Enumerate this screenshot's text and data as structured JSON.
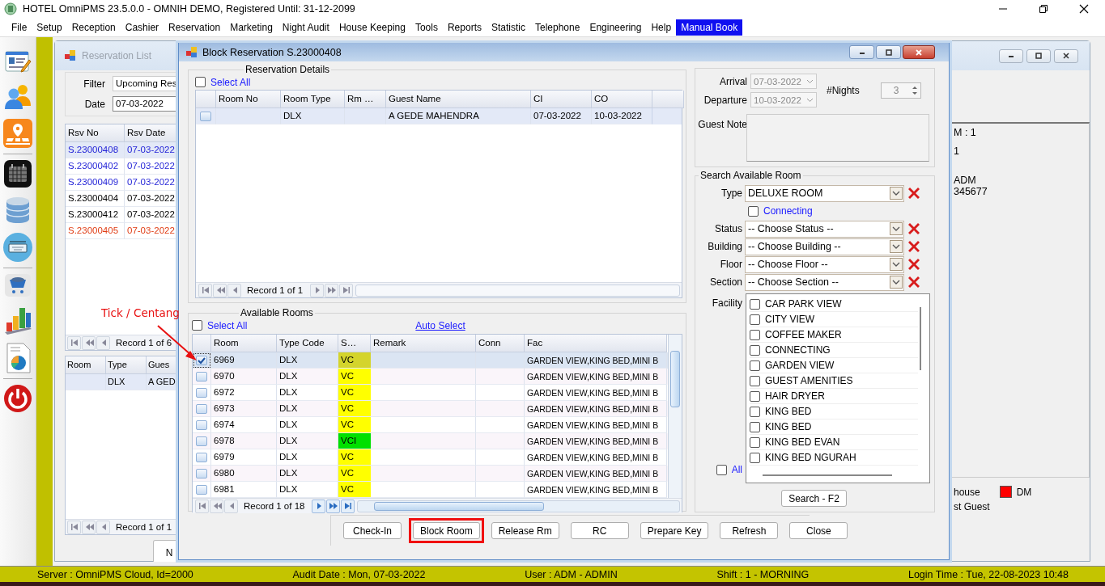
{
  "window": {
    "title": "HOTEL OmniPMS 23.5.0.0 - OMNIH DEMO, Registered Until: 31-12-2099"
  },
  "menu": [
    {
      "label": "File",
      "selected": false
    },
    {
      "label": "Setup",
      "selected": false
    },
    {
      "label": "Reception",
      "selected": false
    },
    {
      "label": "Cashier",
      "selected": false
    },
    {
      "label": "Reservation",
      "selected": false
    },
    {
      "label": "Marketing",
      "selected": false
    },
    {
      "label": "Night Audit",
      "selected": false
    },
    {
      "label": "House Keeping",
      "selected": false
    },
    {
      "label": "Tools",
      "selected": false
    },
    {
      "label": "Reports",
      "selected": false
    },
    {
      "label": "Statistic",
      "selected": false
    },
    {
      "label": "Telephone",
      "selected": false
    },
    {
      "label": "Engineering",
      "selected": false
    },
    {
      "label": "Help",
      "selected": false
    },
    {
      "label": "Manual Book",
      "selected": true
    }
  ],
  "reservation_list": {
    "title": "Reservation List",
    "filter_label": "Filter",
    "filter_value": "Upcoming Res",
    "date_label": "Date",
    "date_value": "07-03-2022",
    "columns": [
      "Rsv No",
      "Rsv Date"
    ],
    "rows": [
      {
        "rsv_no": "S.23000408",
        "rsv_date": "07-03-2022",
        "color": "#1f1fd6",
        "selected": true
      },
      {
        "rsv_no": "S.23000402",
        "rsv_date": "07-03-2022",
        "color": "#1f1fd6",
        "selected": false
      },
      {
        "rsv_no": "S.23000409",
        "rsv_date": "07-03-2022",
        "color": "#1f1fd6",
        "selected": false
      },
      {
        "rsv_no": "S.23000404",
        "rsv_date": "07-03-2022",
        "color": "#000000",
        "selected": false
      },
      {
        "rsv_no": "S.23000412",
        "rsv_date": "07-03-2022",
        "color": "#000000",
        "selected": false
      },
      {
        "rsv_no": "S.23000405",
        "rsv_date": "07-03-2022",
        "color": "#e03c14",
        "selected": false
      }
    ],
    "record": "Record 1 of 6",
    "room_columns": [
      "Room",
      "Type",
      "Gues"
    ],
    "room_rows": [
      [
        "",
        "DLX",
        "A GED"
      ]
    ],
    "room_record": "Record 1 of 1",
    "tab": "N",
    "info_lines": [
      "M : 1",
      "1",
      "ADM",
      "345677"
    ],
    "legend": [
      {
        "label": "house"
      },
      {
        "label": "DM",
        "color": "#ff0000"
      },
      {
        "label": "st Guest"
      }
    ]
  },
  "block_reservation": {
    "title": "Block Reservation S.23000408",
    "details": {
      "title": "Reservation Details",
      "select_all": {
        "label": "Select All",
        "checked": false
      },
      "columns": [
        "Room No",
        "Room Type",
        "Rm …",
        "Guest Name",
        "CI",
        "CO"
      ],
      "rows": [
        {
          "checked": false,
          "selected": true,
          "cells": [
            "",
            "DLX",
            "",
            "A GEDE MAHENDRA",
            "07-03-2022",
            "10-03-2022"
          ]
        }
      ],
      "record": "Record 1 of 1"
    },
    "stay": {
      "arrival_label": "Arrival",
      "arrival": "07-03-2022",
      "departure_label": "Departure",
      "departure": "10-03-2022",
      "nights_label": "#Nights",
      "nights": "3",
      "note_label": "Guest Note"
    },
    "search": {
      "title": "Search Available Room",
      "filters": [
        {
          "label": "Type",
          "value": "DELUXE ROOM"
        },
        {
          "label": "Status",
          "value": "-- Choose Status --"
        },
        {
          "label": "Building",
          "value": "-- Choose Building --"
        },
        {
          "label": "Floor",
          "value": "-- Choose Floor --"
        },
        {
          "label": "Section",
          "value": "-- Choose Section --"
        }
      ],
      "connecting": {
        "label": "Connecting",
        "checked": false
      },
      "facility_label": "Facility",
      "facilities": [
        {
          "label": "CAR PARK VIEW",
          "checked": false
        },
        {
          "label": "CITY VIEW",
          "checked": false
        },
        {
          "label": "COFFEE MAKER",
          "checked": false
        },
        {
          "label": "CONNECTING",
          "checked": false
        },
        {
          "label": "GARDEN VIEW",
          "checked": false
        },
        {
          "label": "GUEST AMENITIES",
          "checked": false
        },
        {
          "label": "HAIR DRYER",
          "checked": false
        },
        {
          "label": "KING BED",
          "checked": false
        },
        {
          "label": "KING BED",
          "checked": false
        },
        {
          "label": "KING BED EVAN",
          "checked": false
        },
        {
          "label": "KING BED NGURAH",
          "checked": false
        }
      ],
      "all": {
        "label": "All",
        "checked": false
      },
      "search_button": "Search - F2"
    },
    "rooms": {
      "title": "Available Rooms",
      "select_all": {
        "label": "Select All",
        "checked": false
      },
      "auto_select": "Auto Select",
      "columns": [
        "Room",
        "Type Code",
        "S…",
        "Remark",
        "Conn",
        "Fac"
      ],
      "rows": [
        {
          "checked": true,
          "selected": true,
          "room": "6969",
          "type": "DLX",
          "status": "VC",
          "color": "#d4d42c",
          "fac": "GARDEN VIEW,KING BED,MINI B"
        },
        {
          "checked": false,
          "selected": false,
          "room": "6970",
          "type": "DLX",
          "status": "VC",
          "color": "#ffff00",
          "fac": "GARDEN VIEW,KING BED,MINI B"
        },
        {
          "checked": false,
          "selected": false,
          "room": "6972",
          "type": "DLX",
          "status": "VC",
          "color": "#ffff00",
          "fac": "GARDEN VIEW,KING BED,MINI B"
        },
        {
          "checked": false,
          "selected": false,
          "room": "6973",
          "type": "DLX",
          "status": "VC",
          "color": "#ffff00",
          "fac": "GARDEN VIEW,KING BED,MINI B"
        },
        {
          "checked": false,
          "selected": false,
          "room": "6974",
          "type": "DLX",
          "status": "VC",
          "color": "#ffff00",
          "fac": "GARDEN VIEW,KING BED,MINI B"
        },
        {
          "checked": false,
          "selected": false,
          "room": "6978",
          "type": "DLX",
          "status": "VCI",
          "color": "#00e000",
          "fac": "GARDEN VIEW,KING BED,MINI B"
        },
        {
          "checked": false,
          "selected": false,
          "room": "6979",
          "type": "DLX",
          "status": "VC",
          "color": "#ffff00",
          "fac": "GARDEN VIEW,KING BED,MINI B"
        },
        {
          "checked": false,
          "selected": false,
          "room": "6980",
          "type": "DLX",
          "status": "VC",
          "color": "#ffff00",
          "fac": "GARDEN VIEW,KING BED,MINI B"
        },
        {
          "checked": false,
          "selected": false,
          "room": "6981",
          "type": "DLX",
          "status": "VC",
          "color": "#ffff00",
          "fac": "GARDEN VIEW,KING BED,MINI B"
        }
      ],
      "record": "Record 1 of 18"
    },
    "buttons": [
      {
        "label": "Check-In",
        "highlighted": false
      },
      {
        "label": "Block Room",
        "highlighted": true
      },
      {
        "label": "Release Rm",
        "highlighted": false
      },
      {
        "label": "RC",
        "highlighted": false
      },
      {
        "label": "Prepare Key",
        "highlighted": false
      },
      {
        "label": "Refresh",
        "highlighted": false
      },
      {
        "label": "Close",
        "highlighted": false
      }
    ]
  },
  "annotation": {
    "text": "Tick / Centang"
  },
  "status_bar": [
    "Server : OmniPMS Cloud, Id=2000",
    "Audit Date : Mon, 07-03-2022",
    "User : ADM - ADMIN",
    "Shift : 1 - MORNING",
    "Login Time : Tue, 22-08-2023 10:48"
  ]
}
